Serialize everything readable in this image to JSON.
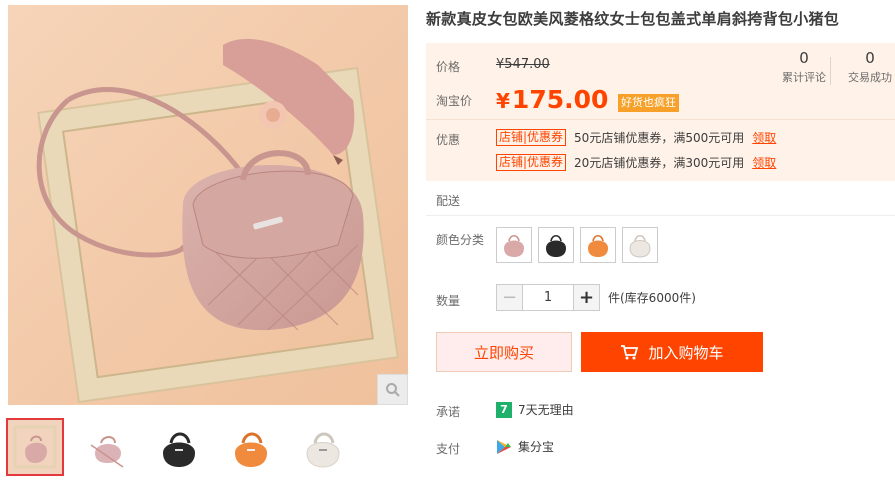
{
  "product": {
    "title": "新款真皮女包欧美风菱格纹女士包包盖式单肩斜挎背包小猪包"
  },
  "price": {
    "label": "价格",
    "original": "¥547.00",
    "taobao_label": "淘宝价",
    "currency": "¥",
    "current": "175.00",
    "promo_tag": "好货也疯狂"
  },
  "stats": {
    "reviews_count": "0",
    "reviews_label": "累计评论",
    "sales_count": "0",
    "sales_label": "交易成功"
  },
  "coupons": {
    "label": "优惠",
    "items": [
      {
        "tag": "店铺|优惠券",
        "text": "50元店铺优惠券，满500元可用",
        "action": "领取"
      },
      {
        "tag": "店铺|优惠券",
        "text": "20元店铺优惠券，满300元可用",
        "action": "领取"
      }
    ]
  },
  "delivery": {
    "label": "配送"
  },
  "color": {
    "label": "颜色分类",
    "options": [
      "pink",
      "black",
      "orange",
      "white"
    ],
    "option_colors": [
      "#d9a9a8",
      "#2a2a2a",
      "#f08a3c",
      "#ece7e1"
    ]
  },
  "quantity": {
    "label": "数量",
    "value": "1",
    "minus": "−",
    "plus": "+",
    "stock": "件(库存6000件)"
  },
  "actions": {
    "buy_now": "立即购买",
    "add_to_cart": "加入购物车"
  },
  "promise": {
    "label": "承诺",
    "icon_text": "7",
    "text": "7天无理由"
  },
  "payment": {
    "label": "支付",
    "text": "集分宝"
  },
  "gallery": {
    "thumb_colors": [
      "#d9a9a8",
      "#dbb3b6",
      "#2a2a2a",
      "#f08a3c",
      "#ece7e1"
    ]
  },
  "colors": {
    "accent": "#ff4400",
    "price_bg": "#fff2e8",
    "promo_tag_bg": "#f7a12b"
  }
}
